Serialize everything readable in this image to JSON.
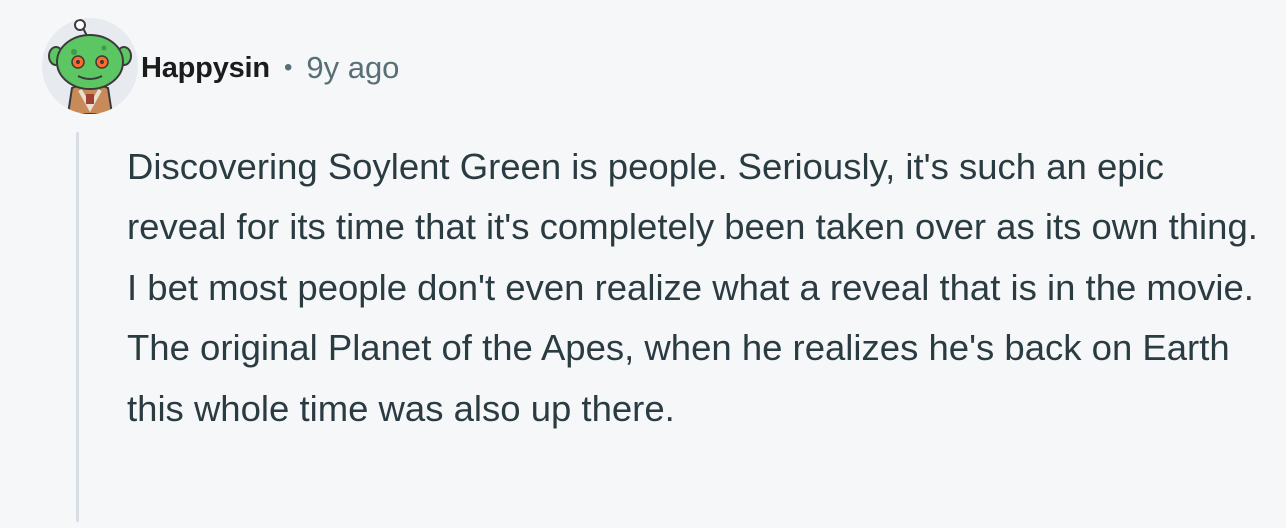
{
  "comment": {
    "author": "Happysin",
    "separator": "•",
    "age": "9y ago",
    "body": "Discovering Soylent Green is people. Seriously, it's such an epic reveal for its time that it's completely been taken over as its own thing. I bet most people don't even realize what a reveal that is in the movie. The original Planet of the Apes, when he realizes he's back on Earth this whole time was also up there."
  },
  "colors": {
    "background": "#f6f7f9",
    "author": "#1c1c1c",
    "meta": "#576f76",
    "body_text": "#2a3c42",
    "thread_line": "#d7dde3",
    "avatar_green": "#5cc663"
  },
  "icons": {
    "avatar": "snoo-avatar-icon"
  }
}
